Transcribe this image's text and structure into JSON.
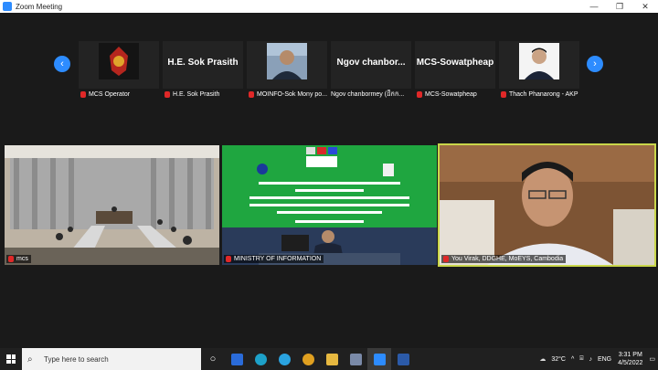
{
  "window": {
    "title": "Zoom Meeting"
  },
  "gallery": {
    "participants": [
      {
        "big_name": "",
        "caption": "MCS Operator"
      },
      {
        "big_name": "H.E. Sok Prasith",
        "caption": "H.E. Sok Prasith"
      },
      {
        "big_name": "",
        "caption": "MOINFO-Sok Mony po..."
      },
      {
        "big_name": "Ngov  chanbor...",
        "caption": "Ngov chanbormey (ដឹកក..."
      },
      {
        "big_name": "MCS-Sowatpheap",
        "caption": "MCS-Sowatpheap"
      },
      {
        "big_name": "",
        "caption": "Thach Phanarong - AKP"
      }
    ]
  },
  "videos": [
    {
      "label": "mcs"
    },
    {
      "label": "MINISTRY OF INFORMATION"
    },
    {
      "label": "You Virak, DDGHE, MoEYS, Cambodia"
    }
  ],
  "taskbar": {
    "search_placeholder": "Type here to search",
    "weather": "32°C",
    "language": "ENG",
    "time": "3:31 PM",
    "date": "4/5/2022"
  }
}
